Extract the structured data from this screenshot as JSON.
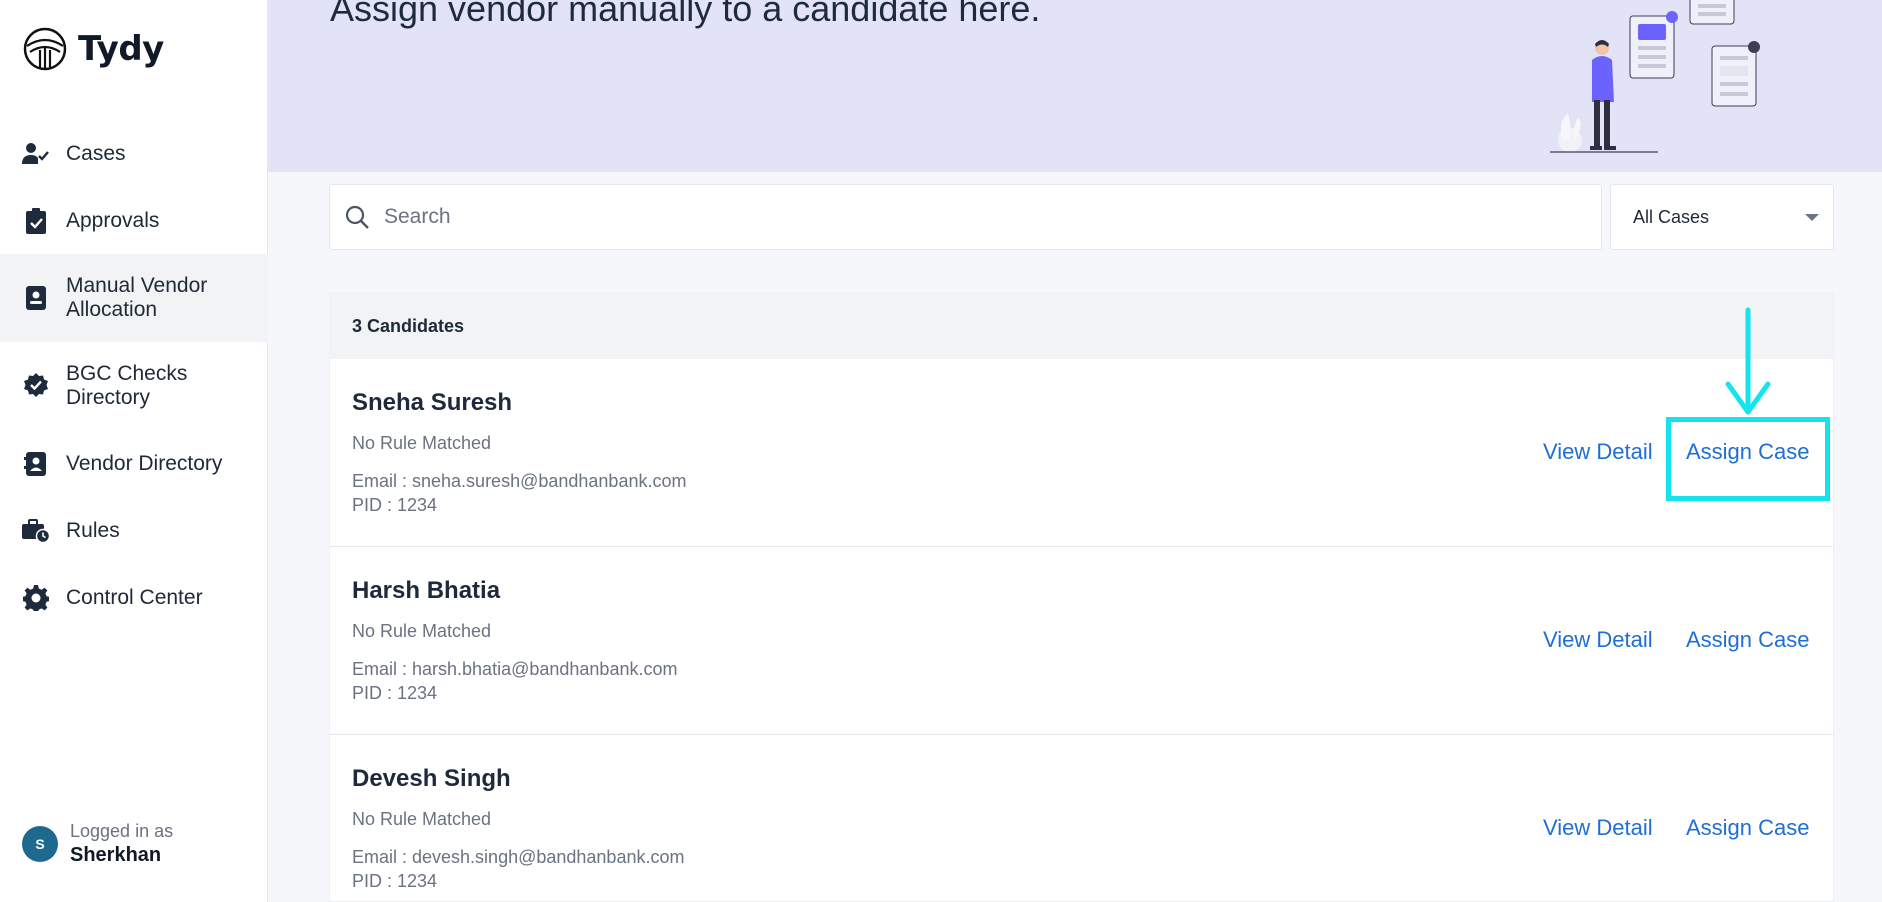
{
  "brand": {
    "name": "Tydy",
    "logo_icon": "tydy-logo-icon"
  },
  "sidebar": {
    "items": [
      {
        "label": "Cases",
        "icon": "user-check-icon"
      },
      {
        "label": "Approvals",
        "icon": "clipboard-check-icon"
      },
      {
        "label": "Manual Vendor Allocation",
        "icon": "contact-book-icon",
        "active": true
      },
      {
        "label": "BGC Checks Directory",
        "icon": "verified-badge-icon"
      },
      {
        "label": "Vendor Directory",
        "icon": "address-book-icon"
      },
      {
        "label": "Rules",
        "icon": "briefcase-clock-icon"
      },
      {
        "label": "Control Center",
        "icon": "gear-icon"
      }
    ]
  },
  "user": {
    "initial": "S",
    "caption": "Logged in as",
    "name": "Sherkhan"
  },
  "banner": {
    "title": "Assign vendor manually to a candidate here."
  },
  "search": {
    "placeholder": "Search",
    "value": ""
  },
  "filter": {
    "selected": "All Cases"
  },
  "list": {
    "count_label": "3 Candidates",
    "rows": [
      {
        "name": "Sneha Suresh",
        "rule": "No Rule Matched",
        "email": "Email : sneha.suresh@bandhanbank.com",
        "pid": "PID : 1234",
        "view": "View Detail",
        "assign": "Assign Case"
      },
      {
        "name": "Harsh Bhatia",
        "rule": "No Rule Matched",
        "email": "Email : harsh.bhatia@bandhanbank.com",
        "pid": "PID : 1234",
        "view": "View Detail",
        "assign": "Assign Case"
      },
      {
        "name": "Devesh Singh",
        "rule": "No Rule Matched",
        "email": "Email : devesh.singh@bandhanbank.com",
        "pid": "PID : 1234",
        "view": "View Detail",
        "assign": "Assign Case"
      }
    ]
  },
  "colors": {
    "accent": "#1d6fd6",
    "banner_bg": "#e2e3f7",
    "highlight": "#16e4ec",
    "sidebar_active": "#f1f3f5"
  }
}
